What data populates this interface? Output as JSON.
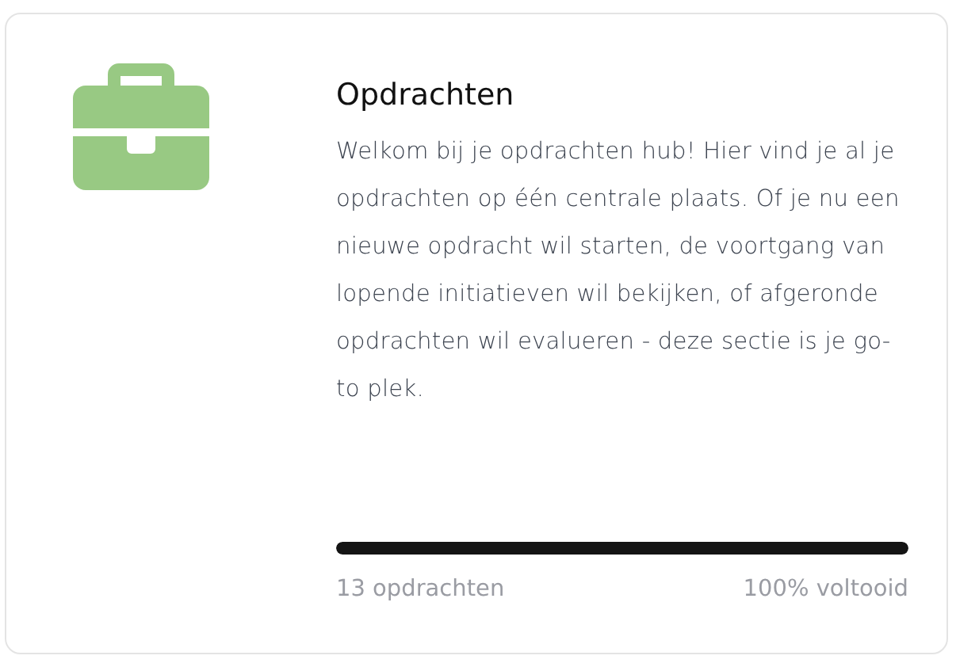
{
  "card": {
    "title": "Opdrachten",
    "description": "Welkom bij je opdrachten hub! Hier vind je al je opdrachten op één centrale plaats. Of je nu een nieuwe opdracht wil starten, de voortgang van lopende initiatieven wil bekijken, of afgeronde opdrachten wil evalueren - deze sectie is je go-to plek.",
    "progress": {
      "level": 1
    },
    "count": "13 opdrachten",
    "completion": "100% voltooid"
  }
}
